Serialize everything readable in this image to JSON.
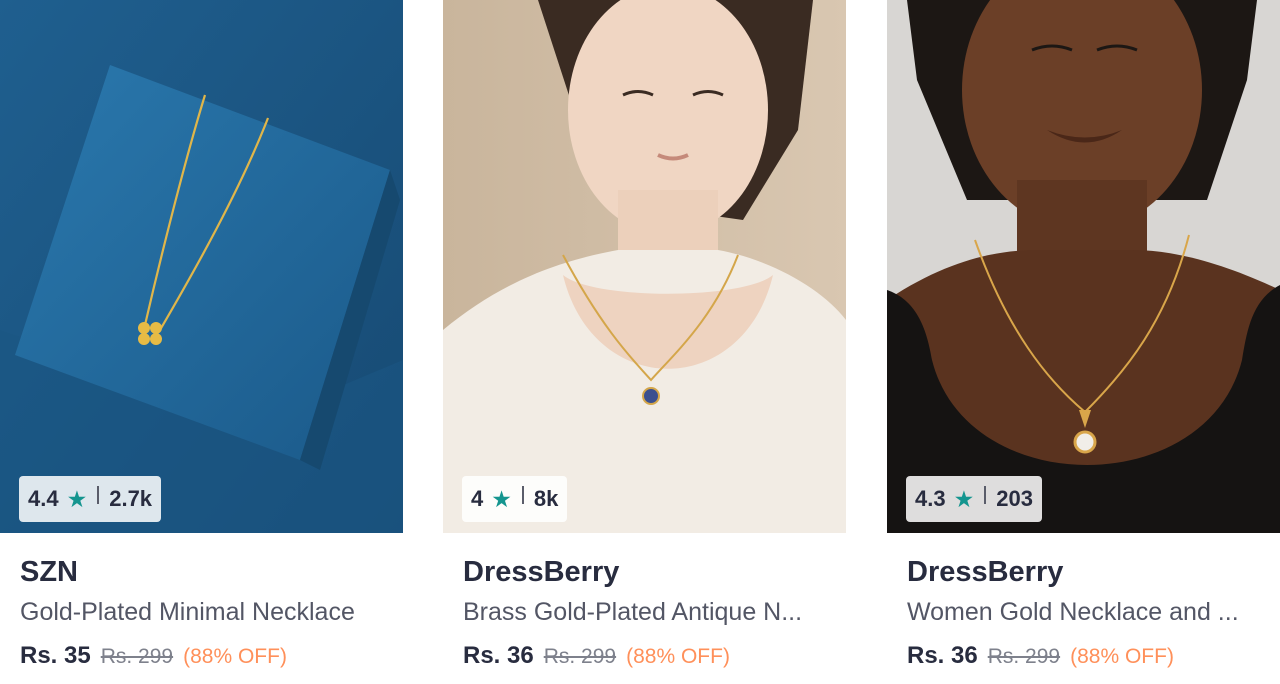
{
  "products": [
    {
      "brand": "SZN",
      "description": "Gold-Plated Minimal Necklace",
      "rating": "4.4",
      "rating_count": "2.7k",
      "price": "Rs. 35",
      "mrp": "Rs. 299",
      "discount": "(88% OFF)",
      "image_icon": "necklace-on-blue-box-image"
    },
    {
      "brand": "DressBerry",
      "description": "Brass Gold-Plated Antique N...",
      "rating": "4",
      "rating_count": "8k",
      "price": "Rs. 36",
      "mrp": "Rs. 299",
      "discount": "(88% OFF)",
      "image_icon": "model-wearing-blue-pendant-image"
    },
    {
      "brand": "DressBerry",
      "description": "Women Gold Necklace and ...",
      "rating": "4.3",
      "rating_count": "203",
      "price": "Rs. 36",
      "mrp": "Rs. 299",
      "discount": "(88% OFF)",
      "image_icon": "model-wearing-crystal-pendant-image"
    }
  ],
  "colors": {
    "star": "#14958f",
    "discount": "#ff905a",
    "text_primary": "#282c3f",
    "text_secondary": "#535665"
  }
}
